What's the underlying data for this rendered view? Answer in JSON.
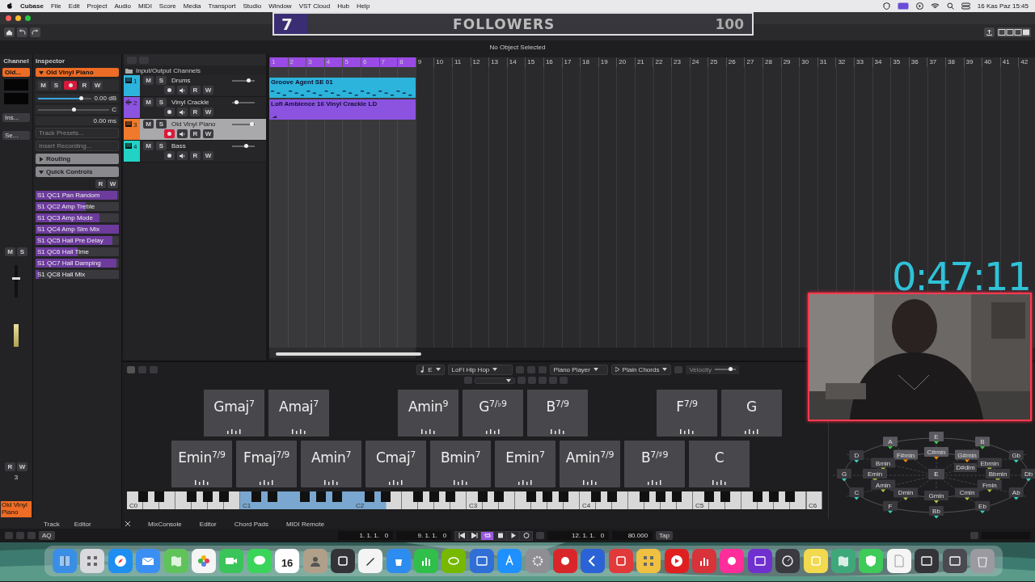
{
  "menubar": {
    "app": "Cubase",
    "menus": [
      "File",
      "Edit",
      "Project",
      "Audio",
      "MIDI",
      "Score",
      "Media",
      "Transport",
      "Studio",
      "Window",
      "VST Cloud",
      "Hub",
      "Help"
    ],
    "clock": "16 Kas Paz 15:45"
  },
  "stream_overlay": {
    "count": "7",
    "label": "FOLLOWERS",
    "goal": "100",
    "level": 0.07,
    "timer": "0:47:11"
  },
  "toolbar": {
    "info": "No Object Selected"
  },
  "channel": {
    "tab": "Channel",
    "track_label": "Old...",
    "insert": "Ins...",
    "send": "Se...",
    "mute": "M",
    "solo": "S",
    "read": "R",
    "write": "W",
    "fader": {
      "level": 0.6
    },
    "track_name": "Old Vinyl Piano",
    "track_number": "3"
  },
  "inspector": {
    "tab": "Inspector",
    "track_name": "Old Vinyl Piano",
    "mute": "M",
    "solo": "S",
    "read": "R",
    "write": "W",
    "record_enabled": true,
    "volume": {
      "reading": "0.00 dB",
      "level": 0.8
    },
    "pan": {
      "reading": "C",
      "level": 0.5
    },
    "delay": "0.00 ms",
    "track_presets": "Track Presets...",
    "insert_recording": "Insert Recording...",
    "routing": {
      "label": "Routing",
      "expanded": false
    },
    "quick_controls": {
      "label": "Quick Controls",
      "expanded": true,
      "read": "R",
      "write": "W",
      "controls": [
        {
          "label": "S1 QC1 Pan Random",
          "level": 0.98
        },
        {
          "label": "S1 QC2 Amp Treble",
          "level": 0.6
        },
        {
          "label": "S1 QC3 Amp Mode",
          "level": 0.77
        },
        {
          "label": "S1 QC4 Amp Sim Mix",
          "level": 1
        },
        {
          "label": "S1 QC5 Hall Pre Delay",
          "level": 0.92
        },
        {
          "label": "S1 QC6 Hall Time",
          "level": 0.5
        },
        {
          "label": "S1 QC7 Hall Damping",
          "level": 0.97
        },
        {
          "label": "S1 QC8 Hall Mix",
          "level": 0.04
        }
      ]
    }
  },
  "tracks": {
    "folder": "Input/Output Channels",
    "items": [
      {
        "number": "1",
        "name": "Drums",
        "kind": "instrument",
        "color": "#2cb4dc",
        "selected": false,
        "record_enabled": false,
        "mute": "M",
        "solo": "S",
        "read": "R",
        "write": "W",
        "volume": {
          "level": 0.72
        },
        "events": [
          {
            "name": "Groove Agent SE 01",
            "kind": "midi"
          }
        ]
      },
      {
        "number": "2",
        "name": "Vinyl Crackle",
        "kind": "audio",
        "color": "#8c52e0",
        "selected": false,
        "record_enabled": false,
        "mute": "M",
        "solo": "S",
        "read": "R",
        "write": "W",
        "volume": {
          "level": 0.18
        },
        "events": [
          {
            "name": "Lofi Ambience 16 Vinyl Crackle LD",
            "kind": "audio"
          }
        ]
      },
      {
        "number": "3",
        "name": "Old Vinyl Piano",
        "kind": "instrument",
        "color": "#f07a2c",
        "selected": true,
        "record_enabled": true,
        "mute": "M",
        "solo": "S",
        "read": "R",
        "write": "W",
        "volume": {
          "level": 0.85
        }
      },
      {
        "number": "4",
        "name": "Bass",
        "kind": "instrument",
        "color": "#22d3c5",
        "selected": false,
        "record_enabled": false,
        "mute": "M",
        "solo": "S",
        "read": "R",
        "write": "W",
        "volume": {
          "level": 0.6
        }
      }
    ]
  },
  "arrange": {
    "ruler": [
      "1",
      "2",
      "3",
      "4",
      "5",
      "6",
      "7",
      "8",
      "9",
      "10",
      "11",
      "12",
      "13",
      "14",
      "15",
      "16",
      "17",
      "18",
      "19",
      "20",
      "21",
      "22",
      "23",
      "24",
      "25",
      "26",
      "27",
      "28",
      "29",
      "30",
      "31",
      "32",
      "33",
      "34",
      "35",
      "36",
      "37",
      "38",
      "39",
      "40",
      "41",
      "42"
    ]
  },
  "chord_pads": {
    "toolbar": {
      "key": "E",
      "style": "LoFi Hip Hop",
      "player": "Piano Player",
      "mode": "Plain Chords",
      "velocity": {
        "label": "Velocity",
        "level": 0.72
      }
    },
    "rows": [
      [
        {
          "kind": "chord",
          "label": "Gmaj$^{7}$"
        },
        {
          "kind": "chord",
          "label": "Amaj$^{7}$"
        },
        {
          "kind": "empty"
        },
        {
          "kind": "chord",
          "label": "Amin$^{9}$"
        },
        {
          "kind": "chord",
          "label": "G$^{7/♭9}$"
        },
        {
          "kind": "chord",
          "label": "B$^{7/9}$"
        },
        {
          "kind": "empty"
        },
        {
          "kind": "chord",
          "label": "F$^{7/9}$"
        },
        {
          "kind": "chord",
          "label": "G"
        }
      ],
      [
        {
          "kind": "chord",
          "label": "Emin$^{7/9}$"
        },
        {
          "kind": "chord",
          "label": "Fmaj$^{7/9}$"
        },
        {
          "kind": "chord",
          "label": "Amin$^{7}$"
        },
        {
          "kind": "chord",
          "label": "Cmaj$^{7}$"
        },
        {
          "kind": "chord",
          "label": "Bmin$^{7}$"
        },
        {
          "kind": "chord",
          "label": "Emin$^{7}$"
        },
        {
          "kind": "chord",
          "label": "Amin$^{7/9}$"
        },
        {
          "kind": "chord",
          "label": "B$^{7/♯9}$"
        },
        {
          "kind": "chord",
          "label": "C"
        }
      ]
    ],
    "keyboard": {
      "octaves": [
        {
          "label": "C0"
        },
        {
          "label": "C1",
          "level": 1
        },
        {
          "label": "C2",
          "level": 0.29
        },
        {
          "label": "C3"
        },
        {
          "label": "C4"
        },
        {
          "label": "C5"
        }
      ],
      "end_key": "C6"
    },
    "circle_of_fifths": {
      "center": "E",
      "diminished": "D#dim",
      "majors": [
        {
          "label": "E",
          "highlighted": true
        },
        {
          "label": "B",
          "highlighted": true
        },
        {
          "label": "Gb",
          "highlighted": false
        },
        {
          "label": "Db",
          "highlighted": false
        },
        {
          "label": "Ab",
          "highlighted": false
        },
        {
          "label": "Eb",
          "highlighted": false
        },
        {
          "label": "Bb",
          "highlighted": false
        },
        {
          "label": "F",
          "highlighted": false
        },
        {
          "label": "C",
          "highlighted": false
        },
        {
          "label": "G",
          "highlighted": false
        },
        {
          "label": "D",
          "highlighted": false
        },
        {
          "label": "A",
          "highlighted": true
        }
      ],
      "minors": [
        {
          "label": "C#min",
          "highlighted": true
        },
        {
          "label": "G#min",
          "highlighted": true
        },
        {
          "label": "Ebmin",
          "highlighted": false
        },
        {
          "label": "Bbmin",
          "highlighted": false
        },
        {
          "label": "Fmin",
          "highlighted": false
        },
        {
          "label": "Cmin",
          "highlighted": false
        },
        {
          "label": "Gmin",
          "highlighted": false
        },
        {
          "label": "Dmin",
          "highlighted": false
        },
        {
          "label": "Amin",
          "highlighted": false
        },
        {
          "label": "Emin",
          "highlighted": false
        },
        {
          "label": "Bmin",
          "highlighted": false
        },
        {
          "label": "F#min",
          "highlighted": true
        }
      ]
    }
  },
  "bottom_tabs": {
    "left": [
      "Track",
      "Editor"
    ],
    "lower": [
      "MixConsole",
      "Editor",
      "Chord Pads",
      "MIDI Remote"
    ]
  },
  "transport": {
    "quantize": "AQ",
    "left_locator": "1. 1. 1.   0",
    "right_locator": "9. 1. 1.   0",
    "cycle_on": true,
    "position": "12. 1. 1.   0",
    "tempo": "80.000",
    "tap": "Tap"
  },
  "dock": {
    "apps": [
      {
        "kind": "finder",
        "color": "#3a8ee6"
      },
      {
        "kind": "grid",
        "color": "#d9d9de"
      },
      {
        "kind": "compass",
        "color": "#1e8ef0"
      },
      {
        "kind": "envelope",
        "color": "#3b8ff3"
      },
      {
        "kind": "map",
        "color": "#5fc35a"
      },
      {
        "kind": "flower",
        "color": "#f5f5f5"
      },
      {
        "kind": "camera",
        "color": "#3bc45a"
      },
      {
        "kind": "bubble",
        "color": "#3bd45a"
      },
      {
        "kind": "calendar",
        "color": "#ffffff",
        "label": "16"
      },
      {
        "kind": "person",
        "color": "#b0a08a"
      },
      {
        "kind": "box",
        "color": "#333338"
      },
      {
        "kind": "pen",
        "color": "#f4f4f4"
      },
      {
        "kind": "podium",
        "color": "#2d8cf0"
      },
      {
        "kind": "bars",
        "color": "#2fbf4a"
      },
      {
        "kind": "eye",
        "color": "#76b900"
      },
      {
        "kind": "window",
        "color": "#2f6fd6"
      },
      {
        "kind": "letter",
        "color": "#1e90ff"
      },
      {
        "kind": "gear",
        "color": "#8e8e93"
      },
      {
        "kind": "circle",
        "color": "#d9262b"
      },
      {
        "kind": "chevron",
        "color": "#2b63d6"
      },
      {
        "kind": "box",
        "color": "#e03a3a"
      },
      {
        "kind": "grid",
        "color": "#f0c040"
      },
      {
        "kind": "play",
        "color": "#e02020"
      },
      {
        "kind": "bars",
        "color": "#d8323a"
      },
      {
        "kind": "circle",
        "color": "#ff2d9a"
      },
      {
        "kind": "window",
        "color": "#7030d0"
      },
      {
        "kind": "gauge",
        "color": "#3a3a40"
      },
      {
        "kind": "box",
        "color": "#f2d94e"
      },
      {
        "kind": "map",
        "color": "#3fa87a"
      },
      {
        "kind": "shield",
        "color": "#3ecb5a"
      },
      {
        "kind": "doc",
        "color": "#f5f5f5"
      },
      {
        "kind": "window",
        "color": "#333338"
      },
      {
        "kind": "window",
        "color": "#4a4a50"
      },
      {
        "kind": "trash",
        "color": "#9a9aa0"
      }
    ]
  }
}
